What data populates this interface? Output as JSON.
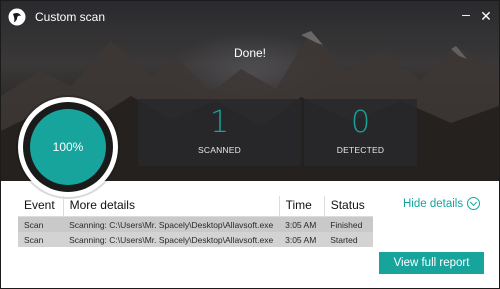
{
  "window": {
    "title": "Custom scan",
    "minimize_symbol": "–",
    "close_symbol": "✕"
  },
  "status": {
    "done_text": "Done!",
    "progress_percent": 100,
    "progress_label": "100%"
  },
  "stats": {
    "scanned": {
      "value": "1",
      "label": "SCANNED"
    },
    "detected": {
      "value": "0",
      "label": "DETECTED"
    }
  },
  "details": {
    "columns": [
      "Event",
      "More details",
      "Time",
      "Status"
    ],
    "rows": [
      [
        "Scan",
        "Scanning: C:\\Users\\Mr. Spacely\\Desktop\\Allavsoft.exe",
        "3:05 AM",
        "Finished"
      ],
      [
        "Scan",
        "Scanning: C:\\Users\\Mr. Spacely\\Desktop\\Allavsoft.exe",
        "3:05 AM",
        "Started"
      ]
    ],
    "hide_label": "Hide details"
  },
  "actions": {
    "full_report_label": "View full report"
  },
  "colors": {
    "accent": "#17a49c",
    "hero_dark": "#1c1a19"
  },
  "icons": {
    "logo": "app-logo-icon",
    "hide": "chevron-down-circle-icon"
  }
}
